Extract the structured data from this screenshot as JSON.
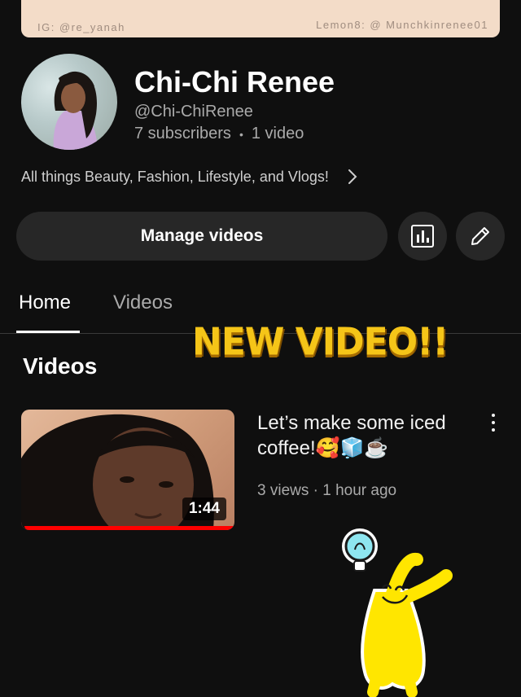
{
  "banner": {
    "instagram": "IG: @re_yanah",
    "lemon8": "Lemon8: @ Munchkinrenee01"
  },
  "channel": {
    "name": "Chi-Chi Renee",
    "handle": "@Chi-ChiRenee",
    "subscribers": "7 subscribers",
    "separator": "•",
    "video_count": "1 video",
    "description": "All things Beauty, Fashion, Lifestyle, and Vlogs!"
  },
  "actions": {
    "manage_videos": "Manage videos",
    "analytics_icon": "bar-chart-icon",
    "edit_icon": "pencil-icon"
  },
  "tabs": [
    {
      "label": "Home",
      "active": true
    },
    {
      "label": "Videos",
      "active": false
    }
  ],
  "section": {
    "title": "Videos",
    "sticker_text": "NEW VIDEO!!"
  },
  "video": {
    "title": "Let’s make some iced coffee!🥰🧊☕",
    "duration": "1:44",
    "meta": "3 views · 1 hour ago",
    "watch_progress": 1.0
  },
  "colors": {
    "background": "#0f0f0f",
    "button": "#272727",
    "progress": "#ff0000",
    "sticker": "#f5c518",
    "banner": "#f3dcc8"
  }
}
